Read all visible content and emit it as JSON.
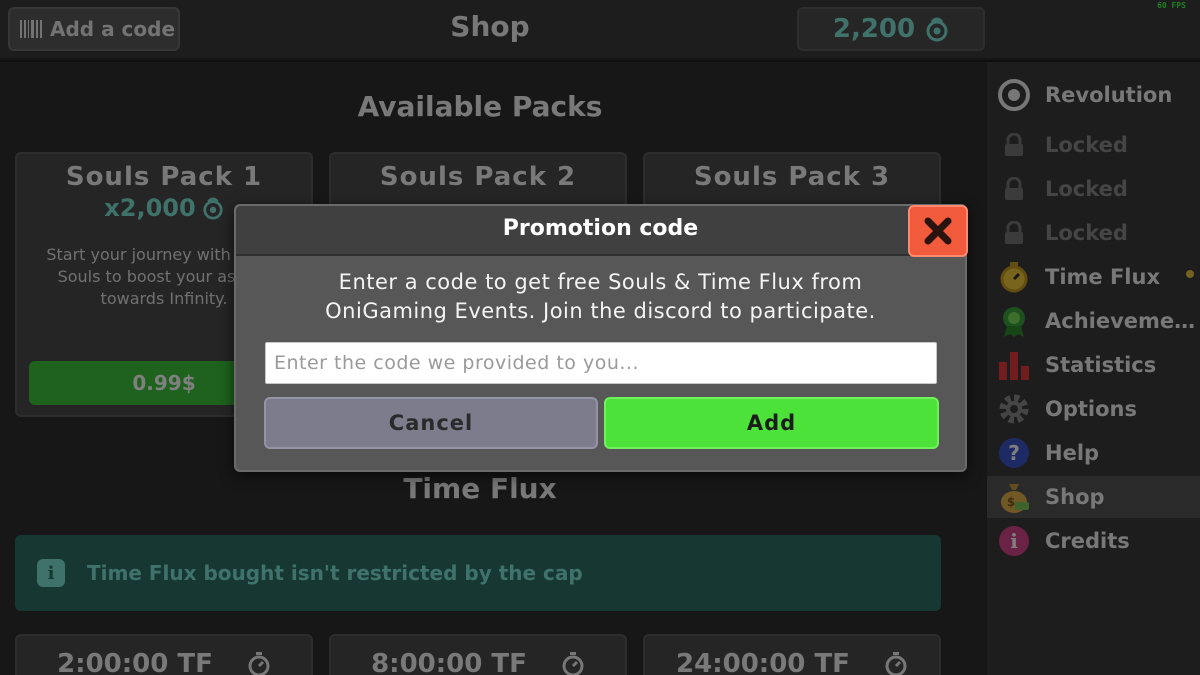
{
  "topbar": {
    "add_code_label": "Add a code",
    "title": "Shop",
    "souls_amount": "2,200",
    "fps": "60 FPS"
  },
  "main": {
    "packs_title": "Available Packs",
    "packs": [
      {
        "name": "Souls Pack 1",
        "amount": "x2,000",
        "description": "Start your journey with 2,000 Souls to boost your ascent towards Infinity.",
        "price": "0.99$"
      },
      {
        "name": "Souls Pack 2"
      },
      {
        "name": "Souls Pack 3"
      }
    ],
    "timeflux_title": "Time Flux",
    "info_text": "Time Flux bought isn't restricted by the cap",
    "timeflux_packs": [
      "2:00:00 TF",
      "8:00:00 TF",
      "24:00:00 TF"
    ]
  },
  "sidebar": {
    "items": [
      {
        "label": "Revolution",
        "icon": "revolution-icon"
      },
      {
        "label": "Locked",
        "icon": "lock-icon"
      },
      {
        "label": "Locked",
        "icon": "lock-icon"
      },
      {
        "label": "Locked",
        "icon": "lock-icon"
      },
      {
        "label": "Time Flux",
        "icon": "stopwatch-icon"
      },
      {
        "label": "Achieveme…",
        "icon": "medal-icon"
      },
      {
        "label": "Statistics",
        "icon": "bar-chart-icon"
      },
      {
        "label": "Options",
        "icon": "gear-icon"
      },
      {
        "label": "Help",
        "icon": "question-icon"
      },
      {
        "label": "Shop",
        "icon": "money-bag-icon"
      },
      {
        "label": "Credits",
        "icon": "info-icon"
      }
    ]
  },
  "dialog": {
    "title": "Promotion code",
    "message_line1": "Enter a code to get free Souls & Time Flux from",
    "message_line2": "OniGaming Events. Join the discord to participate.",
    "input_placeholder": "Enter the code we provided to you...",
    "input_value": "",
    "cancel_label": "Cancel",
    "add_label": "Add"
  },
  "colors": {
    "accent_teal": "#7fe4d4",
    "add_green": "#4de23a",
    "close_red": "#f25a3c"
  }
}
